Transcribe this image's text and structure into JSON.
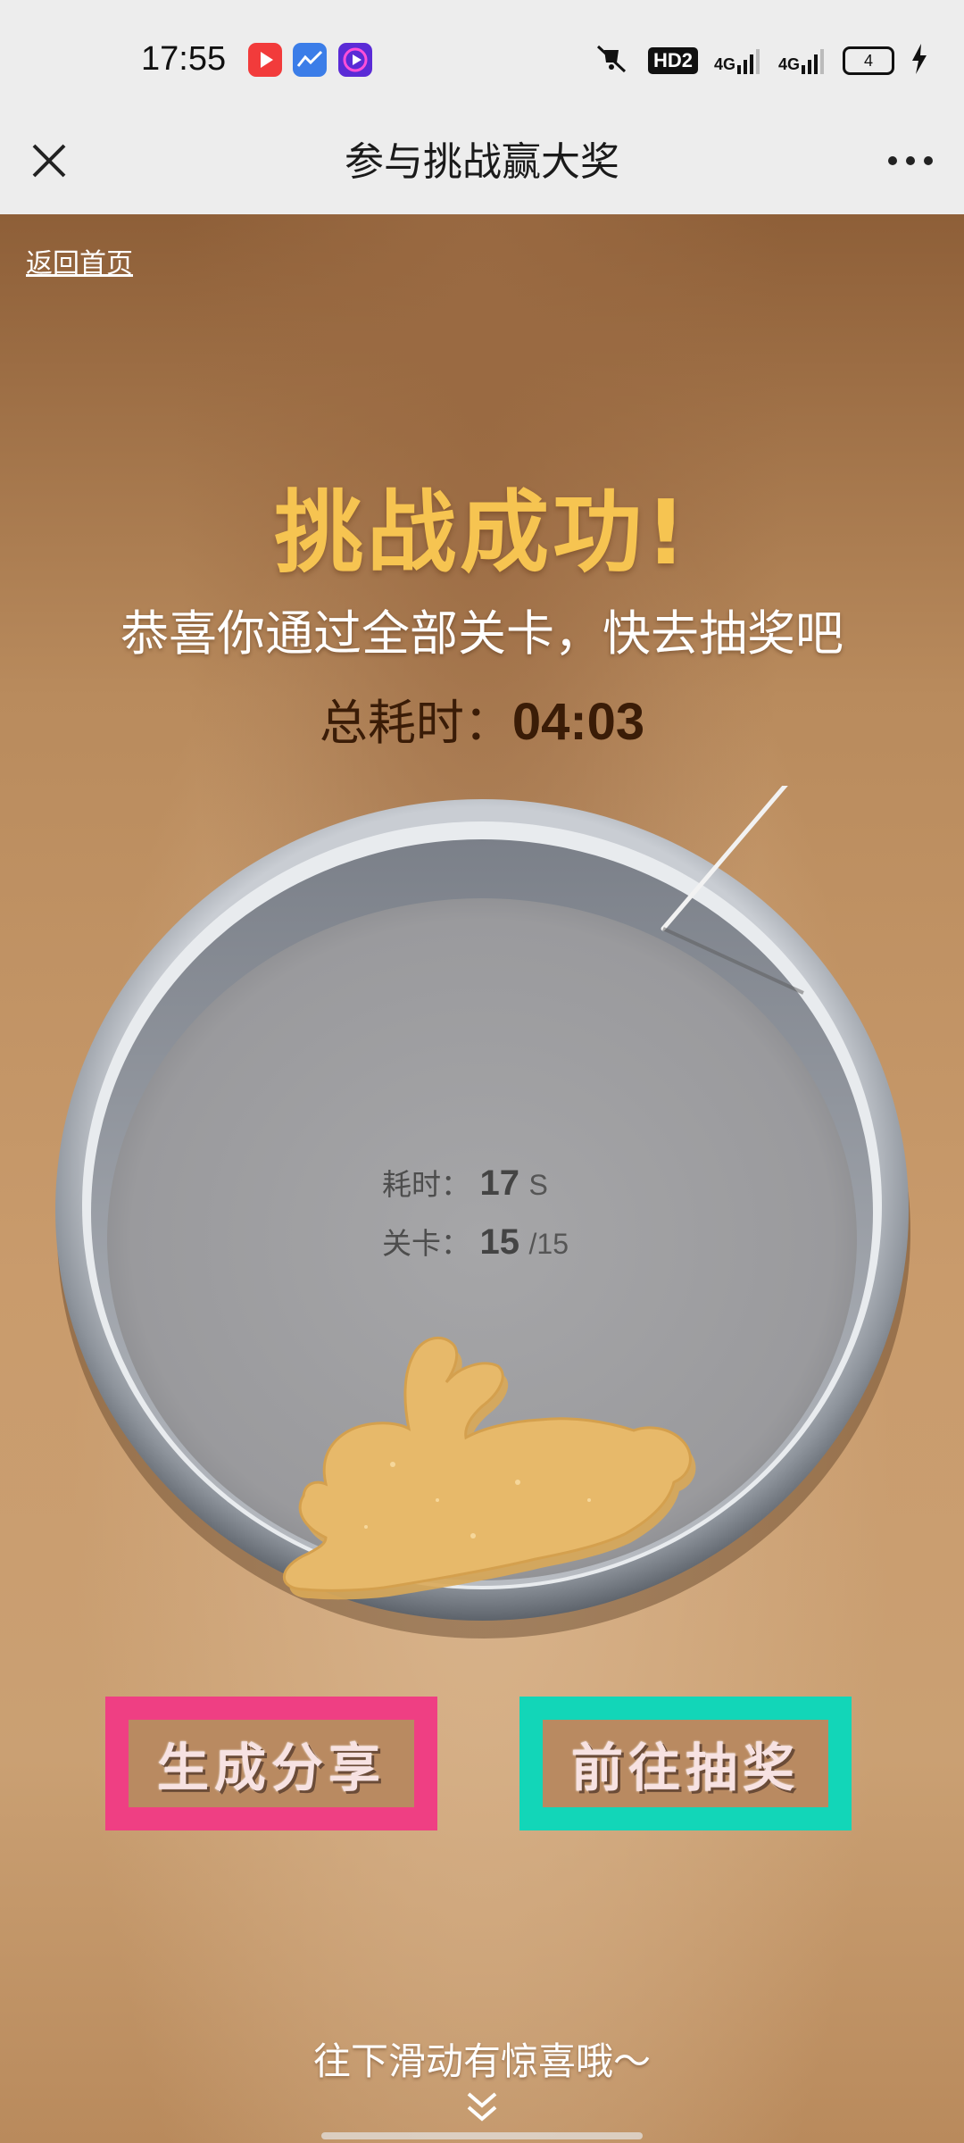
{
  "status_bar": {
    "time": "17:55",
    "app_icons": [
      "video-app-icon",
      "finance-app-icon",
      "media-app-icon"
    ],
    "signal_1": "4G",
    "signal_2": "4G",
    "hd_label": "HD2",
    "battery_level": "4",
    "icons": [
      "mute-icon",
      "hd-icon",
      "signal-icon",
      "signal-icon",
      "battery-icon",
      "charging-icon"
    ]
  },
  "nav": {
    "title": "参与挑战赢大奖",
    "close_icon": "close-icon",
    "more_icon": "more-icon"
  },
  "page": {
    "back_link": "返回首页",
    "success_title": "挑战成功!",
    "congrats_text": "恭喜你通过全部关卡，快去抽奖吧",
    "total_label": "总耗时：",
    "total_time": "04:03",
    "plate": {
      "cookie_shape": "rabbit",
      "needle_icon": "needle-icon",
      "time_label": "耗时：",
      "time_value": "17",
      "time_unit": "S",
      "level_label": "关卡：",
      "level_value": "15",
      "level_total": "/15"
    },
    "buttons": {
      "share_label": "生成分享",
      "lottery_label": "前往抽奖"
    },
    "scroll_hint": "往下滑动有惊喜哦～"
  },
  "colors": {
    "title_yellow": "#f6c451",
    "share_pink": "#ef3f83",
    "lottery_teal": "#12d6b8",
    "cookie": "#e7b96a",
    "total_text": "#3a1c07"
  }
}
